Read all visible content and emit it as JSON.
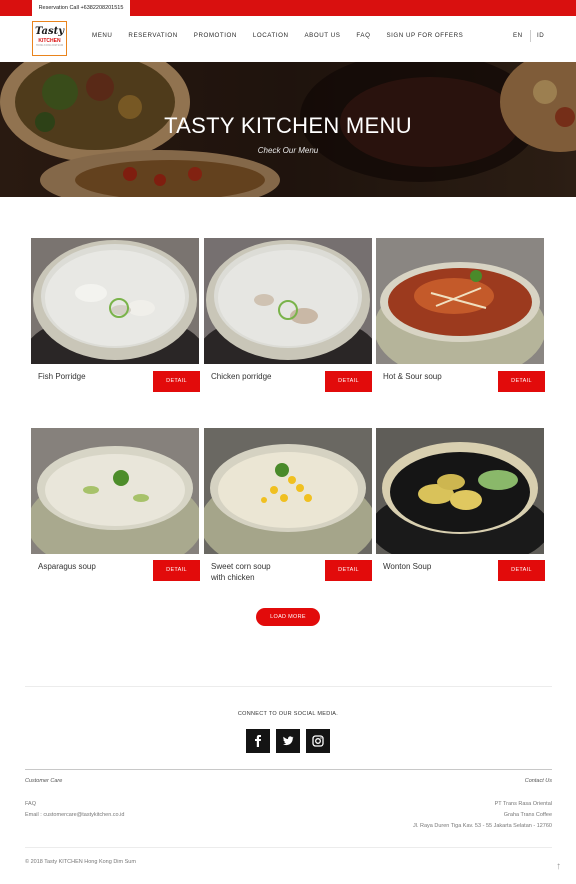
{
  "topbar": {
    "reservation_call": "Reservation Call +6382208201515"
  },
  "logo": {
    "line1": "Tasty",
    "line2": "KITCHEN",
    "line3": "HONG KONG DIM SUM"
  },
  "nav": {
    "items": [
      "MENU",
      "RESERVATION",
      "PROMOTION",
      "LOCATION",
      "ABOUT US",
      "FAQ",
      "SIGN UP FOR OFFERS"
    ]
  },
  "lang": {
    "en": "EN",
    "id": "ID"
  },
  "hero": {
    "title": "TASTY KITCHEN MENU",
    "subtitle": "Check Our Menu"
  },
  "menu": {
    "detail_label": "DETAIL",
    "items": [
      {
        "name": "Fish Porridge"
      },
      {
        "name": "Chicken porridge"
      },
      {
        "name": "Hot & Sour soup"
      },
      {
        "name": "Asparagus soup"
      },
      {
        "name": "Sweet corn soup",
        "name_line2": "with chicken"
      },
      {
        "name": "Wonton Soup"
      }
    ]
  },
  "load_more": "LOAD MORE",
  "social": {
    "heading": "CONNECT TO OUR SOCIAL MEDIA.",
    "icons": [
      "facebook-icon",
      "twitter-icon",
      "instagram-icon"
    ]
  },
  "footer": {
    "customer_care": {
      "heading": "Customer Care",
      "faq": "FAQ",
      "email": "Email : customercare@tastykitchen.co.id"
    },
    "contact": {
      "heading": "Contact Us",
      "company": "PT Trans Rasa Oriental",
      "building": "Graha Trans Coffee",
      "address": "Jl. Raya Duren Tiga Kav. 53 - 55 Jakarta Selatan - 12760"
    },
    "copyright": "© 2018 Tasty KITCHEN Hong Kong Dim Sum",
    "scroll_top": "↑"
  },
  "colors": {
    "accent": "#e20b0b",
    "topbar": "#d9100f",
    "logo_border": "#e9841d"
  }
}
